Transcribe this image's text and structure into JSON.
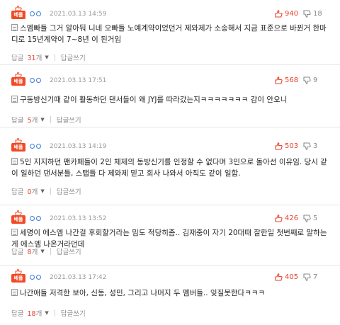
{
  "colors": {
    "accent": "#e8412a",
    "badge": "#f04a25",
    "user_icon": "#3c7bd6"
  },
  "labels": {
    "badge": "베플",
    "reply_prefix": "답글",
    "reply_suffix": "개",
    "write_reply": "답글쓰기"
  },
  "icons": {
    "best": "thumbs-up-crown-icon",
    "like": "thumbs-up-icon",
    "dislike": "thumbs-down-icon",
    "doc": "document-icon",
    "caret": "caret-down-icon"
  },
  "comments": [
    {
      "date": "2021.03.13 14:59",
      "likes": "940",
      "dislikes": "18",
      "text": "스엠빠들 그거 알아둬 니네 오빠들 노예계약이었던거 제와제가 소송해서 지금 표준으로 바뀐거 한마디로 15년계약이 7~8년 이 된거임",
      "reply_count": "31"
    },
    {
      "date": "2021.03.13 17:51",
      "likes": "568",
      "dislikes": "9",
      "text": "구동방신기때 같이 활동하던 댄서들이 왜 JYJ를 따라갔는지ㅋㅋㅋㅋㅋㅋㅋ 감이 안오니",
      "reply_count": "5"
    },
    {
      "date": "2021.03.13 14:19",
      "likes": "503",
      "dislikes": "3",
      "text": "5인 지지하던 팬카페들이 2인 체제의 동방신기를 인정할 수 없다며 3인으로 돌아선 이유임. 당시 같이 일하던 댄서분들, 스탭들 다 제와제 믿고 회사 나와서 아직도 같이 일함.",
      "reply_count": "0"
    },
    {
      "date": "2021.03.13 13:52",
      "likes": "426",
      "dislikes": "5",
      "text": "세명이 에스엠 나간걸 후회할거라는 밈도 적당히좀.. 김재중이 자기 20대때 잘한일 첫번째로 말하는게 에스엠 나온거라던데",
      "reply_count": "8"
    },
    {
      "date": "2021.03.13 17:42",
      "likes": "405",
      "dislikes": "7",
      "text": "나간애들 저격한 보아, 신동, 성민, 그리고 나머지 두 멤버들.. 잊질못한다ㅋㅋㅋ",
      "reply_count": "18"
    }
  ]
}
